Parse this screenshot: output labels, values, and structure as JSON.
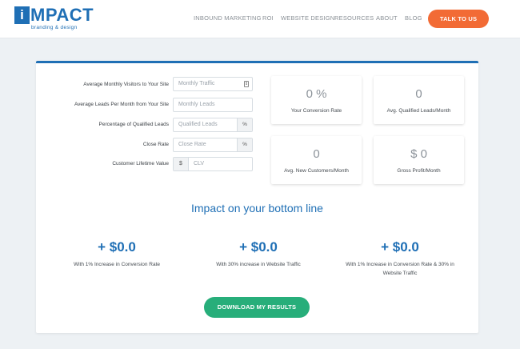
{
  "header": {
    "logo": {
      "box_letter": "i",
      "text": "MPACT",
      "subtitle": "branding & design"
    },
    "nav": [
      {
        "label": "INBOUND MARKETING"
      },
      {
        "label": "ROI"
      },
      {
        "label": "WEBSITE DESIGN"
      },
      {
        "label": "RESOURCES"
      },
      {
        "label": "ABOUT"
      },
      {
        "label": "BLOG"
      }
    ],
    "cta_label": "TALK TO US"
  },
  "form": {
    "rows": [
      {
        "label": "Average Monthly Visitors to Your Site",
        "placeholder": "Monthly Traffic"
      },
      {
        "label": "Average Leads Per Month from Your Site",
        "placeholder": "Monthly Leads"
      },
      {
        "label": "Percentage of Qualified Leads",
        "placeholder": "Qualified Leads",
        "suffix": "%"
      },
      {
        "label": "Close Rate",
        "placeholder": "Close Rate",
        "suffix": "%"
      },
      {
        "label": "Customer Lifetime Value",
        "placeholder": "CLV",
        "prefix": "$"
      }
    ]
  },
  "stats": [
    {
      "value": "0 %",
      "label": "Your Conversion Rate"
    },
    {
      "value": "0",
      "label": "Avg. Qualified Leads/Month"
    },
    {
      "value": "0",
      "label": "Avg. New Customers/Month"
    },
    {
      "value": "$ 0",
      "label": "Gross Profit/Month"
    }
  ],
  "impact": {
    "title": "Impact on your bottom line",
    "results": [
      {
        "value": "+ $0.0",
        "desc": "With 1% Increase in Conversion Rate"
      },
      {
        "value": "+ $0.0",
        "desc": "With 30% increase in Website Traffic"
      },
      {
        "value": "+ $0.0",
        "desc": "With 1% Increase in Conversion Rate & 30% in Website Traffic"
      }
    ],
    "download_label": "DOWNLOAD MY RESULTS"
  },
  "colors": {
    "brand_blue": "#1f6fb5",
    "cta_orange": "#f26b35",
    "download_green": "#27ae7a"
  }
}
